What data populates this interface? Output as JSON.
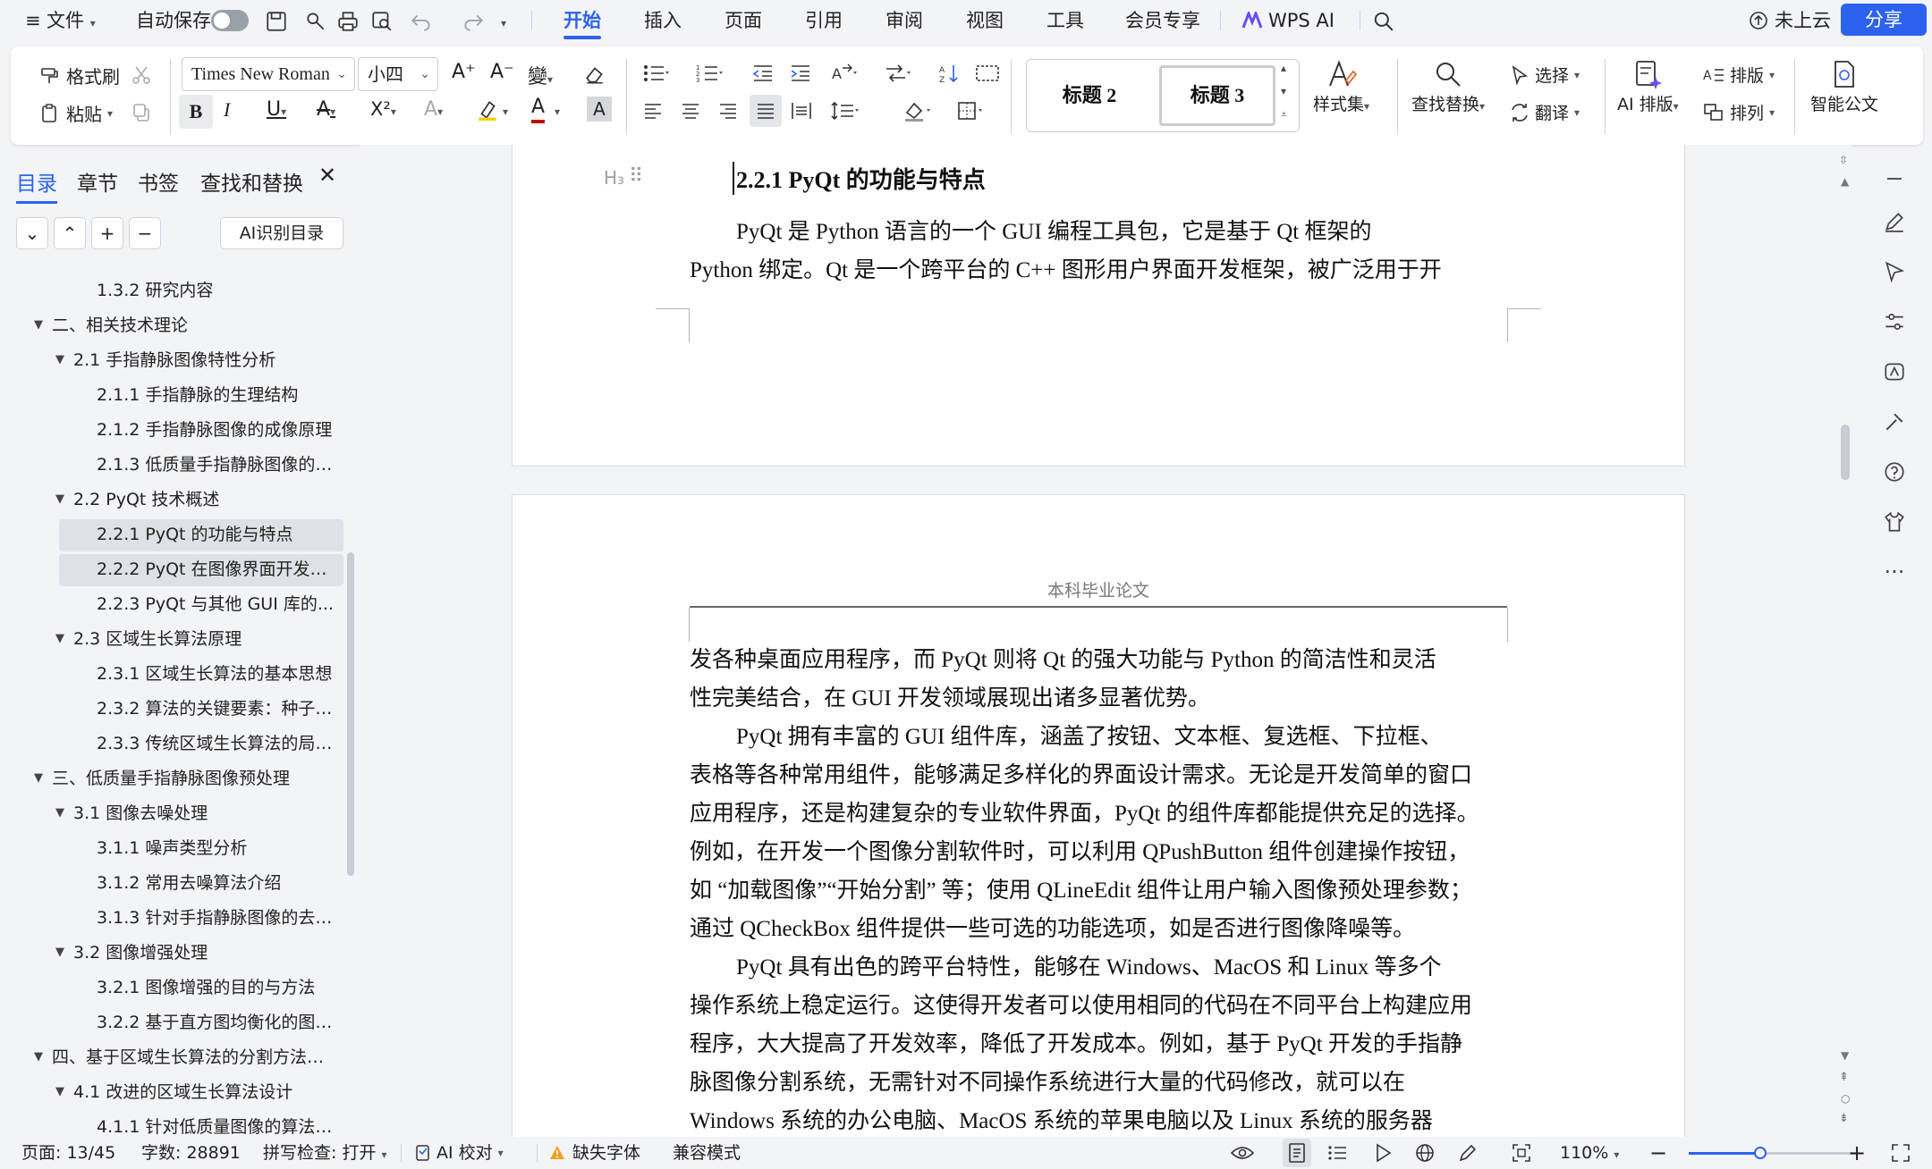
{
  "menubar": {
    "menu_icon": "≡",
    "file_label": "文件",
    "autosave_label": "自动保存",
    "tabs": [
      "开始",
      "插入",
      "页面",
      "引用",
      "审阅",
      "视图",
      "工具",
      "会员专享",
      "WPS AI"
    ],
    "cloud_label": "未上云",
    "share_label": "分享"
  },
  "ribbon": {
    "format_painter": "格式刷",
    "paste": "粘贴",
    "font_name": "Times New Roman",
    "font_size": "小四",
    "bold": "B",
    "italic": "I",
    "underline": "U",
    "strike": "A",
    "superscript": "X²",
    "style_items": [
      "标题 2",
      "标题 3"
    ],
    "style_set": "样式集",
    "find_replace": "查找替换",
    "select": "选择",
    "translate": "翻译",
    "ai_layout": "AI 排版",
    "typeset": "排版",
    "arrange": "排列",
    "smart_doc": "智能公文",
    "accent_color": "#2b62f0"
  },
  "leftpanel": {
    "tabs": [
      "目录",
      "章节",
      "书签",
      "查找和替换"
    ],
    "ai_toc": "AI识别目录",
    "toc": [
      {
        "label": "1.3.2 研究内容",
        "level": 3,
        "tri": false,
        "sel": false
      },
      {
        "label": "二、相关技术理论",
        "level": 1,
        "tri": true,
        "sel": false
      },
      {
        "label": "2.1 手指静脉图像特性分析",
        "level": 2,
        "tri": true,
        "sel": false
      },
      {
        "label": "2.1.1 手指静脉的生理结构",
        "level": 3,
        "tri": false,
        "sel": false
      },
      {
        "label": "2.1.2 手指静脉图像的成像原理",
        "level": 3,
        "tri": false,
        "sel": false
      },
      {
        "label": "2.1.3 低质量手指静脉图像的特...",
        "level": 3,
        "tri": false,
        "sel": false
      },
      {
        "label": "2.2 PyQt 技术概述",
        "level": 2,
        "tri": true,
        "sel": false
      },
      {
        "label": "2.2.1 PyQt 的功能与特点",
        "level": 3,
        "tri": false,
        "sel": true
      },
      {
        "label": "2.2.2 PyQt 在图像界面开发中...",
        "level": 3,
        "tri": false,
        "sel": true
      },
      {
        "label": "2.2.3 PyQt 与其他 GUI 库的...",
        "level": 3,
        "tri": false,
        "sel": false
      },
      {
        "label": "2.3 区域生长算法原理",
        "level": 2,
        "tri": true,
        "sel": false
      },
      {
        "label": "2.3.1 区域生长算法的基本思想",
        "level": 3,
        "tri": false,
        "sel": false
      },
      {
        "label": "2.3.2 算法的关键要素：种子点...",
        "level": 3,
        "tri": false,
        "sel": false
      },
      {
        "label": "2.3.3 传统区域生长算法的局限...",
        "level": 3,
        "tri": false,
        "sel": false
      },
      {
        "label": "三、低质量手指静脉图像预处理",
        "level": 1,
        "tri": true,
        "sel": false
      },
      {
        "label": "3.1 图像去噪处理",
        "level": 2,
        "tri": true,
        "sel": false
      },
      {
        "label": "3.1.1 噪声类型分析",
        "level": 3,
        "tri": false,
        "sel": false
      },
      {
        "label": "3.1.2 常用去噪算法介绍",
        "level": 3,
        "tri": false,
        "sel": false
      },
      {
        "label": "3.1.3 针对手指静脉图像的去噪...",
        "level": 3,
        "tri": false,
        "sel": false
      },
      {
        "label": "3.2 图像增强处理",
        "level": 2,
        "tri": true,
        "sel": false
      },
      {
        "label": "3.2.1 图像增强的目的与方法",
        "level": 3,
        "tri": false,
        "sel": false
      },
      {
        "label": "3.2.2 基于直方图均衡化的图像...",
        "level": 3,
        "tri": false,
        "sel": false
      },
      {
        "label": "四、基于区域生长算法的分割方法设...",
        "level": 1,
        "tri": true,
        "sel": false
      },
      {
        "label": "4.1 改进的区域生长算法设计",
        "level": 2,
        "tri": true,
        "sel": false
      },
      {
        "label": "4.1.1 针对低质量图像的算法改...",
        "level": 3,
        "tri": false,
        "sel": false
      }
    ]
  },
  "document": {
    "heading": "2.2.1 PyQt  的功能与特点",
    "page1_lines": [
      "PyQt  是  Python  语言的一个  GUI  编程工具包，它是基于  Qt  框架的",
      "Python  绑定。Qt  是一个跨平台的  C++  图形用户界面开发框架，被广泛用于开"
    ],
    "page_header": "本科毕业论文",
    "page2_lines": [
      "发各种桌面应用程序，而  PyQt  则将  Qt  的强大功能与  Python  的简洁性和灵活",
      "性完美结合，在  GUI  开发领域展现出诸多显著优势。",
      "PyQt  拥有丰富的  GUI  组件库，涵盖了按钮、文本框、复选框、下拉框、",
      "表格等各种常用组件，能够满足多样化的界面设计需求。无论是开发简单的窗口",
      "应用程序，还是构建复杂的专业软件界面，PyQt  的组件库都能提供充足的选择。",
      "例如，在开发一个图像分割软件时，可以利用  QPushButton  组件创建操作按钮，",
      "如 “加载图像”“开始分割” 等；使用  QLineEdit  组件让用户输入图像预处理参数；",
      "通过  QCheckBox  组件提供一些可选的功能选项，如是否进行图像降噪等。",
      "PyQt  具有出色的跨平台特性，能够在  Windows、MacOS  和  Linux  等多个",
      "操作系统上稳定运行。这使得开发者可以使用相同的代码在不同平台上构建应用",
      "程序，大大提高了开发效率，降低了开发成本。例如，基于  PyQt  开发的手指静",
      "脉图像分割系统，无需针对不同操作系统进行大量的代码修改，就可以在",
      "Windows  系统的办公电脑、MacOS  系统的苹果电脑以及  Linux  系统的服务器"
    ]
  },
  "statusbar": {
    "page": "页面: 13/45",
    "words": "字数: 28891",
    "spell": "拼写检查: 打开",
    "ai_check": "AI 校对",
    "missing_font": "缺失字体",
    "compat": "兼容模式",
    "zoom": "110%"
  }
}
